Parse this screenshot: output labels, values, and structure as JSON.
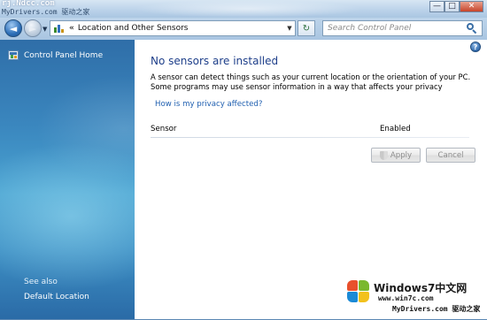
{
  "watermark": {
    "top_line1": "rj.Ndcc.com",
    "top_line2": "MyDrivers.com 驱动之家",
    "brand": "Windows7中文网",
    "url": "www.win7c.com",
    "site": "MyDrivers.com 驱动之家"
  },
  "window_controls": {
    "minimize": "—",
    "maximize": "□",
    "close": "✕"
  },
  "navbar": {
    "back": "◄",
    "forward": "►",
    "history_dropdown": "▼",
    "address_separator": "«",
    "address_text": "Location and Other Sensors",
    "address_dropdown": "▼",
    "refresh": "↻",
    "search_placeholder": "Search Control Panel"
  },
  "sidebar": {
    "home_link": "Control Panel Home",
    "see_also": "See also",
    "default_location": "Default Location"
  },
  "main": {
    "help": "?",
    "title": "No sensors are installed",
    "description": "A sensor can detect things such as your current location or the orientation of your PC. Some programs may use sensor information in a way that affects your privacy",
    "privacy_link": "How is my privacy affected?",
    "columns": {
      "sensor": "Sensor",
      "enabled": "Enabled"
    },
    "buttons": {
      "apply": "Apply",
      "cancel": "Cancel"
    }
  }
}
